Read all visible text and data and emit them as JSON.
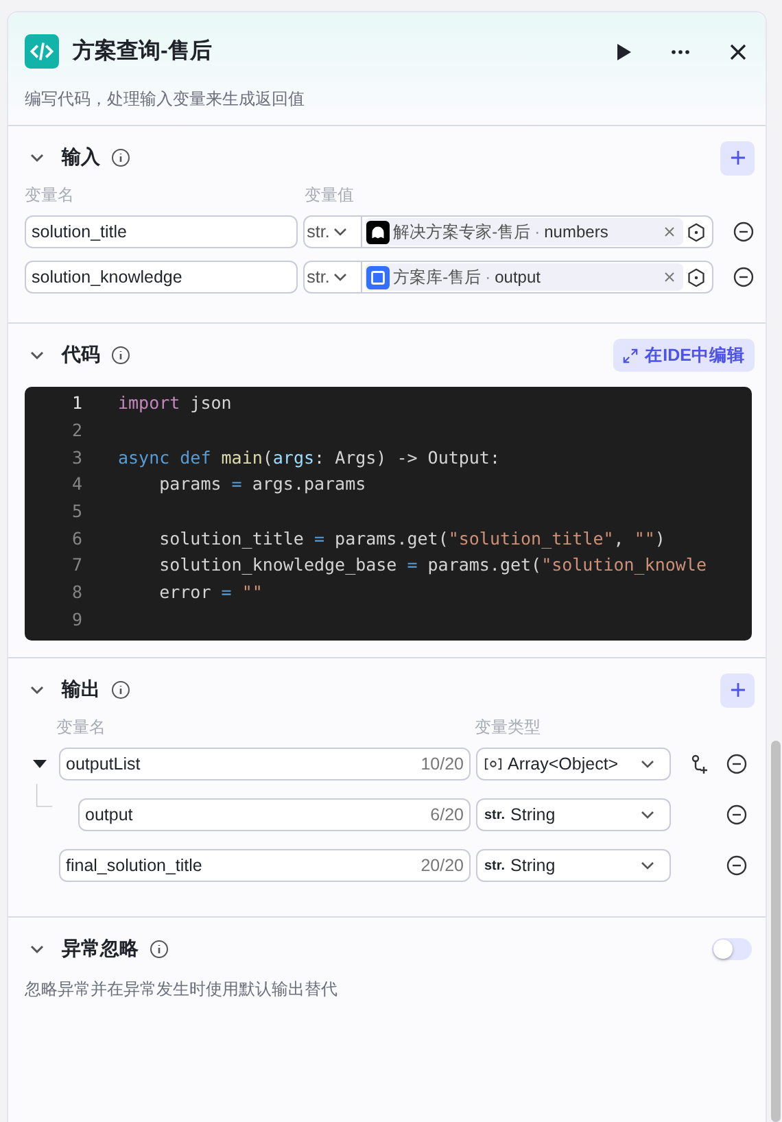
{
  "header": {
    "title": "方案查询-售后",
    "description": "编写代码，处理输入变量来生成返回值"
  },
  "inputs": {
    "title": "输入",
    "columns": [
      "变量名",
      "变量值"
    ],
    "rows": [
      {
        "name": "solution_title",
        "type": "str.",
        "kind": "agent",
        "source": "解决方案专家-售后",
        "separator": "·",
        "field": "numbers"
      },
      {
        "name": "solution_knowledge",
        "type": "str.",
        "kind": "knowledge",
        "source": "方案库-售后",
        "separator": "·",
        "field": "output"
      }
    ]
  },
  "code": {
    "title": "代码",
    "ide_button": "在IDE中编辑",
    "lines": [
      {
        "number": "1",
        "tokens": [
          {
            "kind": "keyword",
            "text": "import"
          },
          {
            "kind": "text",
            "text": " json"
          }
        ]
      },
      {
        "number": "2"
      },
      {
        "number": "3",
        "tokens": [
          {
            "kind": "storage",
            "text": "async def "
          },
          {
            "kind": "function",
            "text": "main"
          },
          {
            "kind": "text",
            "text": "("
          },
          {
            "kind": "param",
            "text": "args"
          },
          {
            "kind": "text",
            "text": ": Args) -> Output:"
          }
        ]
      },
      {
        "number": "4",
        "tokens": [
          {
            "kind": "text",
            "text": "    params "
          },
          {
            "kind": "operator",
            "text": "="
          },
          {
            "kind": "text",
            "text": " args.params"
          }
        ]
      },
      {
        "number": "5"
      },
      {
        "number": "6",
        "tokens": [
          {
            "kind": "text",
            "text": "    solution_title "
          },
          {
            "kind": "operator",
            "text": "="
          },
          {
            "kind": "text",
            "text": " params.get("
          },
          {
            "kind": "string",
            "text": "\"solution_title\""
          },
          {
            "kind": "text",
            "text": ", "
          },
          {
            "kind": "string",
            "text": "\"\""
          },
          {
            "kind": "text",
            "text": ")"
          }
        ]
      },
      {
        "number": "7",
        "tokens": [
          {
            "kind": "text",
            "text": "    solution_knowledge_base "
          },
          {
            "kind": "operator",
            "text": "="
          },
          {
            "kind": "text",
            "text": " params.get("
          },
          {
            "kind": "string",
            "text": "\"solution_knowle"
          }
        ]
      },
      {
        "number": "8",
        "tokens": [
          {
            "kind": "text",
            "text": "    error "
          },
          {
            "kind": "operator",
            "text": "="
          },
          {
            "kind": "string",
            "text": " \"\""
          }
        ]
      },
      {
        "number": "9"
      }
    ]
  },
  "outputs": {
    "title": "输出",
    "columns": [
      "变量名",
      "变量类型"
    ],
    "rows": [
      {
        "name": "outputList",
        "count": "10/20",
        "kind": "array",
        "type": "Array<Object>",
        "expanded": true,
        "children": [
          {
            "name": "output",
            "count": "6/20",
            "kind": "string",
            "type_badge": "str.",
            "type": "String"
          }
        ]
      },
      {
        "name": "final_solution_title",
        "count": "20/20",
        "kind": "string",
        "type_badge": "str.",
        "type": "String"
      }
    ]
  },
  "exception": {
    "title": "异常忽略",
    "description": "忽略异常并在异常发生时使用默认输出替代",
    "on": false
  }
}
